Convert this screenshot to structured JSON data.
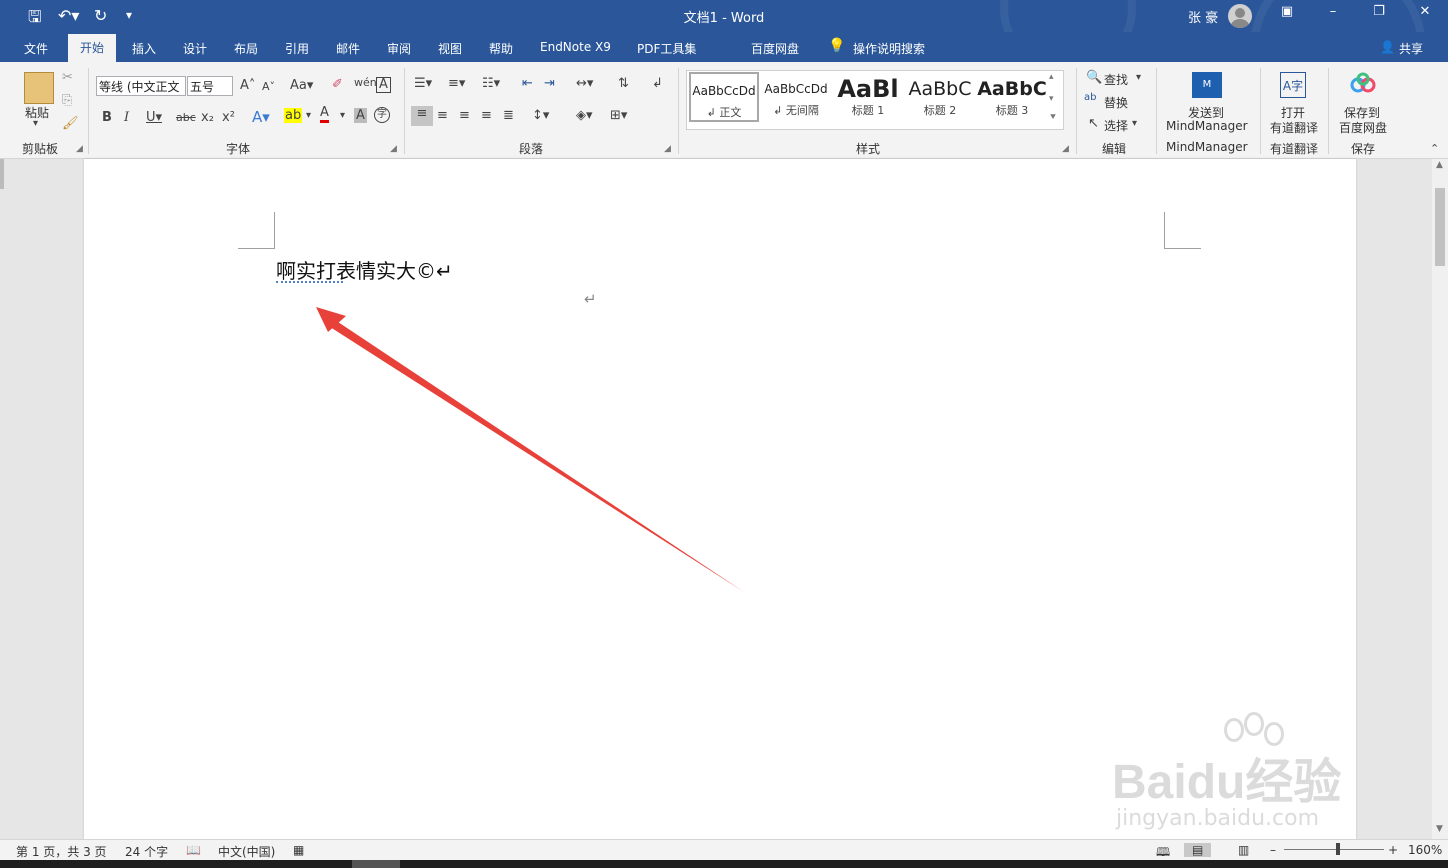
{
  "title_bar": {
    "document_title": "文档1  -  Word",
    "user_name": "张 豪",
    "qat_icons": [
      "save-icon",
      "undo-icon",
      "redo-icon",
      "customize-qat-icon"
    ],
    "window_controls": [
      "ribbon-display-icon",
      "minimize-icon",
      "restore-icon",
      "close-icon"
    ]
  },
  "tabs": [
    {
      "label": "文件"
    },
    {
      "label": "开始",
      "active": true
    },
    {
      "label": "插入"
    },
    {
      "label": "设计"
    },
    {
      "label": "布局"
    },
    {
      "label": "引用"
    },
    {
      "label": "邮件"
    },
    {
      "label": "审阅"
    },
    {
      "label": "视图"
    },
    {
      "label": "帮助"
    },
    {
      "label": "EndNote X9"
    },
    {
      "label": "PDF工具集"
    },
    {
      "label": "百度网盘"
    }
  ],
  "tell_me": "操作说明搜索",
  "share": "共享",
  "ribbon": {
    "clipboard": {
      "label": "剪贴板",
      "paste": "粘贴"
    },
    "font": {
      "label": "字体",
      "font_name": "等线 (中文正文",
      "font_size": "五号"
    },
    "paragraph": {
      "label": "段落"
    },
    "styles": {
      "label": "样式",
      "items": [
        {
          "sample": "AaBbCcDd",
          "name": "↲ 正文"
        },
        {
          "sample": "AaBbCcDd",
          "name": "↲ 无间隔"
        },
        {
          "sample": "AaBl",
          "name": "标题 1"
        },
        {
          "sample": "AaBbC",
          "name": "标题 2"
        },
        {
          "sample": "AaBbC",
          "name": "标题 3"
        }
      ]
    },
    "editing": {
      "label": "编辑",
      "find": "查找",
      "replace": "替换",
      "select": "选择"
    },
    "mindmanager": {
      "label": "MindManager",
      "button_line1": "发送到",
      "button_line2": "MindManager"
    },
    "youdao": {
      "label": "有道翻译",
      "button_line1": "打开",
      "button_line2": "有道翻译"
    },
    "baidu": {
      "label": "保存",
      "button_line1": "保存到",
      "button_line2": "百度网盘"
    }
  },
  "document": {
    "line1": "啊实打表情实大©↵",
    "empty_paragraph_mark": "↵"
  },
  "status_bar": {
    "page": "第 1 页，共 3 页",
    "words": "24 个字",
    "language": "中文(中国)",
    "zoom": "160%"
  },
  "watermark": {
    "logo": "Baidu经验",
    "url": "jingyan.baidu.com"
  },
  "annotation_arrow_color": "#e8413a",
  "accent_color": "#2b579a"
}
